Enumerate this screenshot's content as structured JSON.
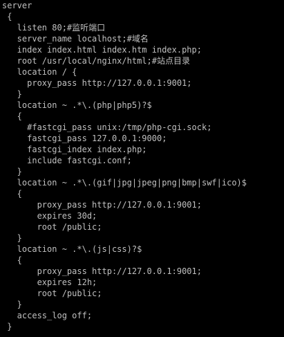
{
  "terminal": {
    "colors": {
      "background": "#000000",
      "foreground": "#c0c0c0"
    },
    "lines": [
      "server",
      " {",
      "   listen 80;#监听端口",
      "   server_name localhost;#域名",
      "   index index.html index.htm index.php;",
      "   root /usr/local/nginx/html;#站点目录",
      "   location / {",
      "     proxy_pass http://127.0.0.1:9001;",
      "   }",
      "   location ~ .*\\.(php|php5)?$",
      "   {",
      "     #fastcgi_pass unix:/tmp/php-cgi.sock;",
      "     fastcgi_pass 127.0.0.1:9000;",
      "     fastcgi_index index.php;",
      "     include fastcgi.conf;",
      "   }",
      "   location ~ .*\\.(gif|jpg|jpeg|png|bmp|swf|ico)$",
      "   {",
      "       proxy_pass http://127.0.0.1:9001;",
      "       expires 30d;",
      "       root /public;",
      "   }",
      "   location ~ .*\\.(js|css)?$",
      "   {",
      "       proxy_pass http://127.0.0.1:9001;",
      "       expires 12h;",
      "       root /public;",
      "   }",
      "   access_log off;",
      " }"
    ]
  }
}
